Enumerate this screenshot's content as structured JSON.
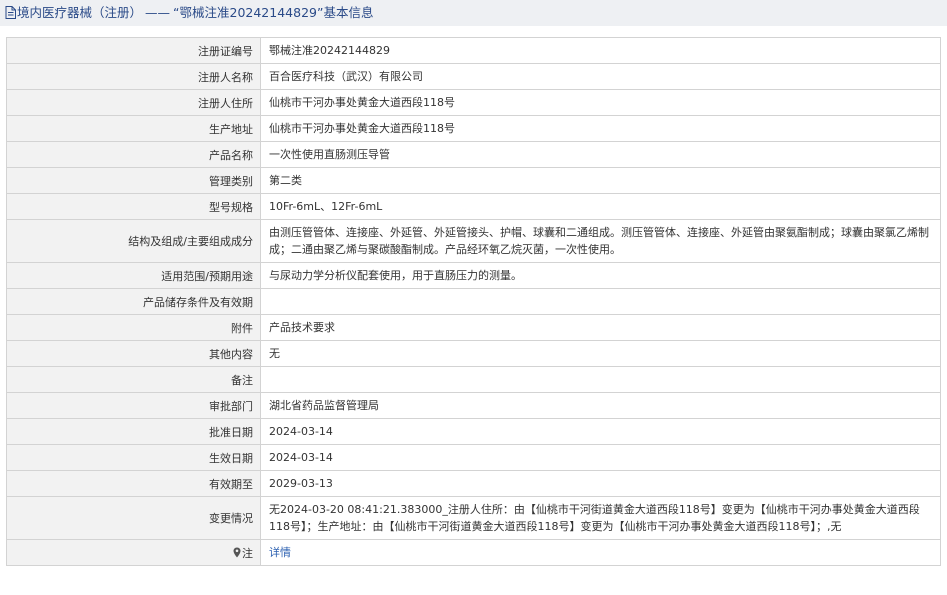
{
  "header": {
    "section": "境内医疗器械（注册）",
    "separator": "——",
    "title": "“鄂械注准20242144829”基本信息"
  },
  "rows": [
    {
      "label": "注册证编号",
      "value": "鄂械注准20242144829"
    },
    {
      "label": "注册人名称",
      "value": "百合医疗科技（武汉）有限公司"
    },
    {
      "label": "注册人住所",
      "value": "仙桃市干河办事处黄金大道西段118号"
    },
    {
      "label": "生产地址",
      "value": "仙桃市干河办事处黄金大道西段118号"
    },
    {
      "label": "产品名称",
      "value": "一次性使用直肠测压导管"
    },
    {
      "label": "管理类别",
      "value": "第二类"
    },
    {
      "label": "型号规格",
      "value": "10Fr-6mL、12Fr-6mL"
    },
    {
      "label": "结构及组成/主要组成成分",
      "value": "由测压管管体、连接座、外延管、外延管接头、护帽、球囊和二通组成。测压管管体、连接座、外延管由聚氨酯制成；球囊由聚氯乙烯制成；二通由聚乙烯与聚碳酸酯制成。产品经环氧乙烷灭菌，一次性使用。"
    },
    {
      "label": "适用范围/预期用途",
      "value": "与尿动力学分析仪配套使用，用于直肠压力的测量。"
    },
    {
      "label": "产品储存条件及有效期",
      "value": ""
    },
    {
      "label": "附件",
      "value": "产品技术要求"
    },
    {
      "label": "其他内容",
      "value": "无"
    },
    {
      "label": "备注",
      "value": ""
    },
    {
      "label": "审批部门",
      "value": "湖北省药品监督管理局"
    },
    {
      "label": "批准日期",
      "value": "2024-03-14"
    },
    {
      "label": "生效日期",
      "value": "2024-03-14"
    },
    {
      "label": "有效期至",
      "value": "2029-03-13"
    },
    {
      "label": "变更情况",
      "value": "无2024-03-20 08:41:21.383000_注册人住所：由【仙桃市干河街道黄金大道西段118号】变更为【仙桃市干河办事处黄金大道西段118号】；生产地址：由【仙桃市干河街道黄金大道西段118号】变更为【仙桃市干河办事处黄金大道西段118号】；,无"
    }
  ],
  "note": {
    "label": "注",
    "link_text": "详情",
    "icon": "map-pin-icon"
  }
}
